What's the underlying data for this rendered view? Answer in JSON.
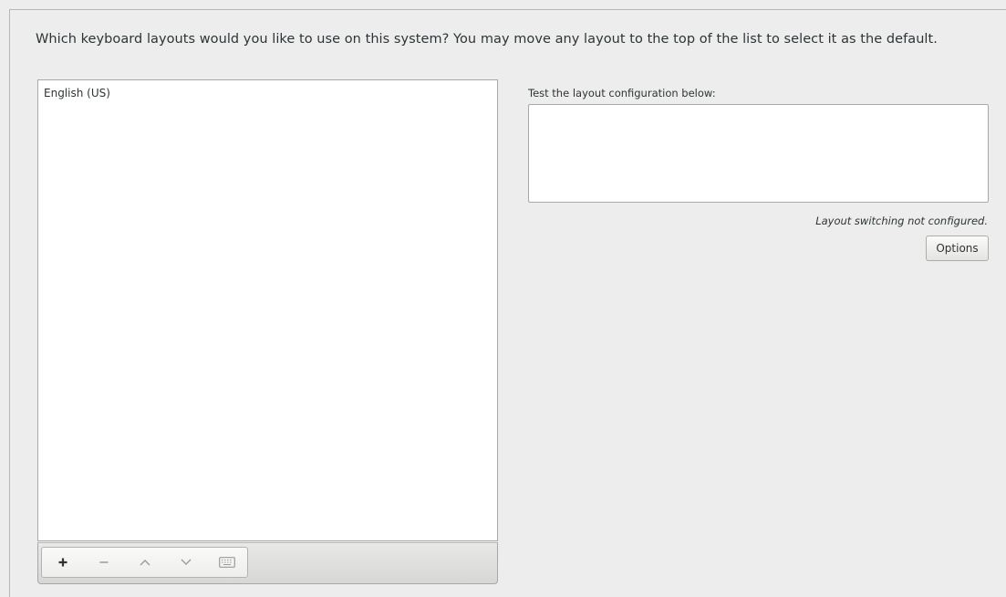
{
  "prompt": "Which keyboard layouts would you like to use on this system?  You may move any layout to the top of the list to select it as the default.",
  "layouts": {
    "items": [
      "English (US)"
    ]
  },
  "toolbar": {
    "buttons": [
      {
        "name": "add-layout-button",
        "icon": "plus-icon"
      },
      {
        "name": "remove-layout-button",
        "icon": "minus-icon"
      },
      {
        "name": "move-up-button",
        "icon": "chevron-up-icon"
      },
      {
        "name": "move-down-button",
        "icon": "chevron-down-icon"
      },
      {
        "name": "preview-layout-button",
        "icon": "keyboard-icon"
      }
    ]
  },
  "test": {
    "label": "Test the layout configuration below:",
    "value": ""
  },
  "switching": {
    "status": "Layout switching not configured.",
    "options_label": "Options"
  }
}
